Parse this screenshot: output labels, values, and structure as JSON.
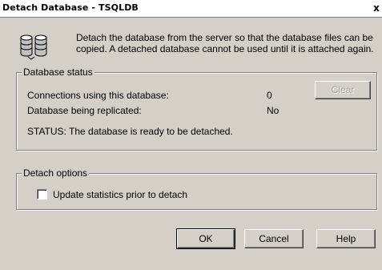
{
  "window": {
    "title": "Detach Database - TSQLDB",
    "close_glyph": "x"
  },
  "description": "Detach the database from the server so that the database files can be copied. A detached database cannot be used until it is attached again.",
  "database_status": {
    "group_label": "Database status",
    "connections_label": "Connections using this database:",
    "connections_value": "0",
    "clear_button": "Clear",
    "replicated_label": "Database being replicated:",
    "replicated_value": "No",
    "status_text": "STATUS:  The database is ready to be detached."
  },
  "detach_options": {
    "group_label": "Detach options",
    "update_statistics_label": "Update statistics prior to detach",
    "update_statistics_checked": false
  },
  "buttons": {
    "ok": "OK",
    "cancel": "Cancel",
    "help": "Help"
  },
  "icon": "database-icon"
}
